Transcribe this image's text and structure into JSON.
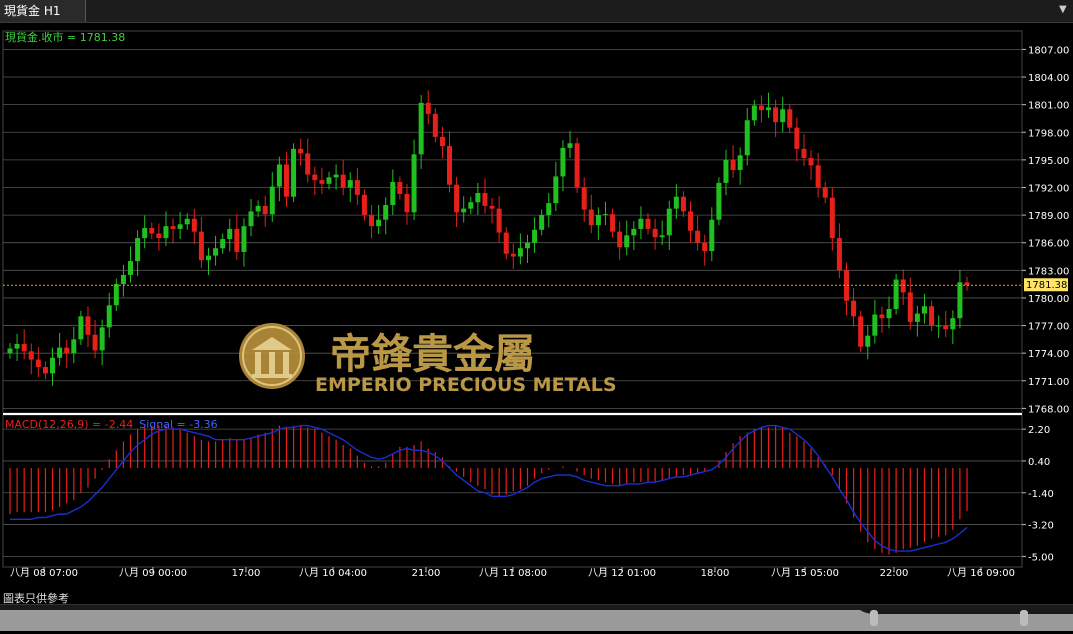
{
  "window": {
    "tab_title": "現貨金 H1"
  },
  "price_panel": {
    "label": "現貨金.收市 = 1781.38",
    "current_price": "1781.38",
    "y_ticks": [
      "1807.00",
      "1804.00",
      "1801.00",
      "1798.00",
      "1795.00",
      "1792.00",
      "1789.00",
      "1786.00",
      "1783.00",
      "1780.00",
      "1777.00",
      "1774.00",
      "1771.00",
      "1768.00"
    ]
  },
  "macd_panel": {
    "label_macd": "MACD(12,26,9) = -2.44",
    "label_signal": "Signal = -3.36",
    "y_ticks": [
      "2.20",
      "0.40",
      "-1.40",
      "-3.20",
      "-5.00"
    ]
  },
  "x_ticks": [
    "八月 08 07:00",
    "八月 09 00:00",
    "17:00",
    "八月 10 04:00",
    "21:00",
    "八月 11 08:00",
    "八月 12 01:00",
    "18:00",
    "八月 15 05:00",
    "22:00",
    "八月 16 09:00"
  ],
  "watermark": {
    "chinese": "帝鋒貴金屬",
    "english": "EMPERIO PRECIOUS METALS"
  },
  "footer": {
    "note": "圖表只供參考"
  },
  "colors": {
    "up": "#21c021",
    "down": "#e8201a",
    "signal": "#1a2fd0",
    "gold": "#c9a44a",
    "price_line": "#e8a020"
  },
  "chart_data": {
    "type": "candlestick",
    "title": "現貨金 H1",
    "close": [
      1774.5,
      1775.0,
      1774.2,
      1773.3,
      1772.5,
      1771.8,
      1773.5,
      1774.6,
      1774.0,
      1775.5,
      1778.0,
      1776.0,
      1774.3,
      1776.8,
      1779.2,
      1781.5,
      1782.5,
      1784.0,
      1786.5,
      1787.6,
      1787.0,
      1786.5,
      1787.8,
      1787.5,
      1788.0,
      1788.6,
      1787.2,
      1784.1,
      1784.6,
      1785.4,
      1786.4,
      1787.5,
      1785.0,
      1787.8,
      1789.4,
      1790.0,
      1789.1,
      1792.1,
      1794.5,
      1791.0,
      1796.2,
      1795.7,
      1793.4,
      1792.8,
      1792.4,
      1793.1,
      1793.4,
      1792.0,
      1792.8,
      1791.2,
      1789.0,
      1787.8,
      1788.5,
      1790.1,
      1792.6,
      1791.3,
      1789.3,
      1795.6,
      1801.2,
      1800.0,
      1797.5,
      1796.5,
      1792.3,
      1789.3,
      1789.7,
      1790.4,
      1791.4,
      1790.0,
      1789.7,
      1787.1,
      1784.8,
      1784.5,
      1785.4,
      1786.0,
      1787.4,
      1789.0,
      1790.3,
      1793.2,
      1796.3,
      1796.8,
      1792.0,
      1789.6,
      1787.9,
      1789.0,
      1789.1,
      1787.2,
      1785.5,
      1786.8,
      1787.5,
      1788.6,
      1787.5,
      1786.6,
      1786.8,
      1789.7,
      1791.0,
      1789.4,
      1787.3,
      1786.0,
      1785.1,
      1788.5,
      1792.5,
      1795.0,
      1793.9,
      1795.5,
      1799.3,
      1800.9,
      1800.4,
      1800.7,
      1799.1,
      1800.5,
      1798.5,
      1796.2,
      1795.2,
      1794.4,
      1792.0,
      1790.9,
      1786.5,
      1783.0,
      1779.7,
      1778.0,
      1774.7,
      1775.9,
      1778.2,
      1777.8,
      1778.8,
      1782.0,
      1780.6,
      1777.4,
      1778.3,
      1779.1,
      1777.0,
      1777.0,
      1776.6,
      1777.8,
      1781.7,
      1781.38
    ],
    "macd_hist": [
      -2.6,
      -2.5,
      -2.5,
      -2.5,
      -2.5,
      -2.5,
      -2.4,
      -2.2,
      -2.0,
      -1.8,
      -1.4,
      -1.1,
      -0.6,
      -0.1,
      0.5,
      1.0,
      1.5,
      1.9,
      2.2,
      2.3,
      2.4,
      2.4,
      2.4,
      2.3,
      2.2,
      2.0,
      1.8,
      1.6,
      1.5,
      1.5,
      1.6,
      1.7,
      1.6,
      1.6,
      1.7,
      1.9,
      2.0,
      2.2,
      2.4,
      2.3,
      2.4,
      2.4,
      2.3,
      2.2,
      2.0,
      1.8,
      1.6,
      1.3,
      1.1,
      0.7,
      0.3,
      0.1,
      0.1,
      0.3,
      0.8,
      1.2,
      1.2,
      1.3,
      1.5,
      1.1,
      0.9,
      0.6,
      0.1,
      -0.2,
      -0.5,
      -0.8,
      -1.0,
      -1.2,
      -1.5,
      -1.6,
      -1.5,
      -1.3,
      -1.2,
      -1.0,
      -0.6,
      -0.3,
      -0.1,
      0.0,
      0.1,
      0.0,
      -0.2,
      -0.4,
      -0.6,
      -0.7,
      -0.8,
      -0.9,
      -1.0,
      -0.9,
      -0.8,
      -0.8,
      -0.8,
      -0.8,
      -0.7,
      -0.6,
      -0.5,
      -0.4,
      -0.4,
      -0.3,
      -0.2,
      0.0,
      0.4,
      0.9,
      1.4,
      1.8,
      2.0,
      2.2,
      2.3,
      2.3,
      2.4,
      2.3,
      2.0,
      1.8,
      1.5,
      1.1,
      0.6,
      0.2,
      -0.4,
      -1.2,
      -2.0,
      -2.8,
      -3.6,
      -4.2,
      -4.6,
      -4.8,
      -4.9,
      -4.8,
      -4.6,
      -4.5,
      -4.4,
      -4.2,
      -4.0,
      -3.9,
      -3.8,
      -3.5,
      -2.9,
      -2.44
    ],
    "signal": [
      -2.9,
      -2.9,
      -2.9,
      -2.9,
      -2.8,
      -2.8,
      -2.7,
      -2.6,
      -2.6,
      -2.4,
      -2.2,
      -1.9,
      -1.5,
      -1.1,
      -0.6,
      -0.1,
      0.4,
      0.9,
      1.3,
      1.6,
      1.9,
      2.1,
      2.2,
      2.2,
      2.2,
      2.1,
      2.0,
      1.9,
      1.8,
      1.6,
      1.6,
      1.6,
      1.6,
      1.6,
      1.7,
      1.8,
      1.9,
      2.0,
      2.2,
      2.3,
      2.3,
      2.4,
      2.4,
      2.3,
      2.2,
      2.0,
      1.8,
      1.6,
      1.3,
      1.0,
      0.8,
      0.6,
      0.5,
      0.6,
      0.8,
      1.0,
      1.1,
      1.0,
      1.0,
      0.9,
      0.7,
      0.4,
      0.0,
      -0.4,
      -0.7,
      -1.0,
      -1.3,
      -1.4,
      -1.6,
      -1.6,
      -1.6,
      -1.5,
      -1.3,
      -1.1,
      -0.8,
      -0.6,
      -0.5,
      -0.4,
      -0.4,
      -0.4,
      -0.5,
      -0.7,
      -0.8,
      -0.9,
      -1.0,
      -1.0,
      -1.0,
      -0.9,
      -0.9,
      -0.9,
      -0.8,
      -0.8,
      -0.7,
      -0.6,
      -0.5,
      -0.5,
      -0.4,
      -0.3,
      -0.2,
      -0.1,
      0.2,
      0.6,
      1.1,
      1.5,
      1.9,
      2.1,
      2.3,
      2.4,
      2.4,
      2.3,
      2.2,
      1.9,
      1.6,
      1.2,
      0.7,
      0.1,
      -0.5,
      -1.2,
      -1.8,
      -2.5,
      -3.1,
      -3.6,
      -4.1,
      -4.4,
      -4.6,
      -4.7,
      -4.7,
      -4.7,
      -4.6,
      -4.5,
      -4.4,
      -4.3,
      -4.2,
      -4.0,
      -3.7,
      -3.36
    ],
    "price_ylim": [
      1767.5,
      1809.0
    ],
    "macd_ylim": [
      -5.6,
      3.0
    ]
  }
}
